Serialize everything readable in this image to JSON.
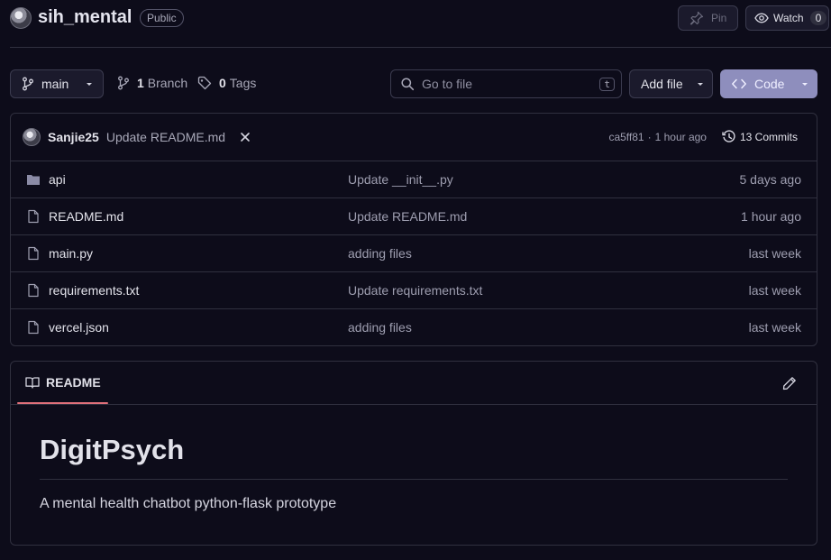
{
  "header": {
    "repo_name": "sih_mental",
    "visibility": "Public",
    "pin_label": "Pin",
    "watch_label": "Watch",
    "watch_count": "0"
  },
  "toolbar": {
    "branch": "main",
    "branch_count": "1",
    "branch_label": "Branch",
    "tag_count": "0",
    "tag_label": "Tags",
    "search_placeholder": "Go to file",
    "search_shortcut": "t",
    "add_file_label": "Add file",
    "code_label": "Code"
  },
  "commit": {
    "author": "Sanjie25",
    "message": "Update README.md",
    "hash": "ca5ff81",
    "separator": "·",
    "time": "1 hour ago",
    "commits_label": "13 Commits"
  },
  "files": [
    {
      "name": "api",
      "type": "folder",
      "message": "Update __init__.py",
      "time": "5 days ago"
    },
    {
      "name": "README.md",
      "type": "file",
      "message": "Update README.md",
      "time": "1 hour ago"
    },
    {
      "name": "main.py",
      "type": "file",
      "message": "adding files",
      "time": "last week"
    },
    {
      "name": "requirements.txt",
      "type": "file",
      "message": "Update requirements.txt",
      "time": "last week"
    },
    {
      "name": "vercel.json",
      "type": "file",
      "message": "adding files",
      "time": "last week"
    }
  ],
  "readme": {
    "tab_label": "README",
    "heading": "DigitPsych",
    "body": "A mental health chatbot python-flask prototype"
  },
  "colors": {
    "background": "#0d0c1a",
    "border": "#30303f",
    "code_button": "#8e8ebd",
    "tab_underline": "#e0707a"
  }
}
